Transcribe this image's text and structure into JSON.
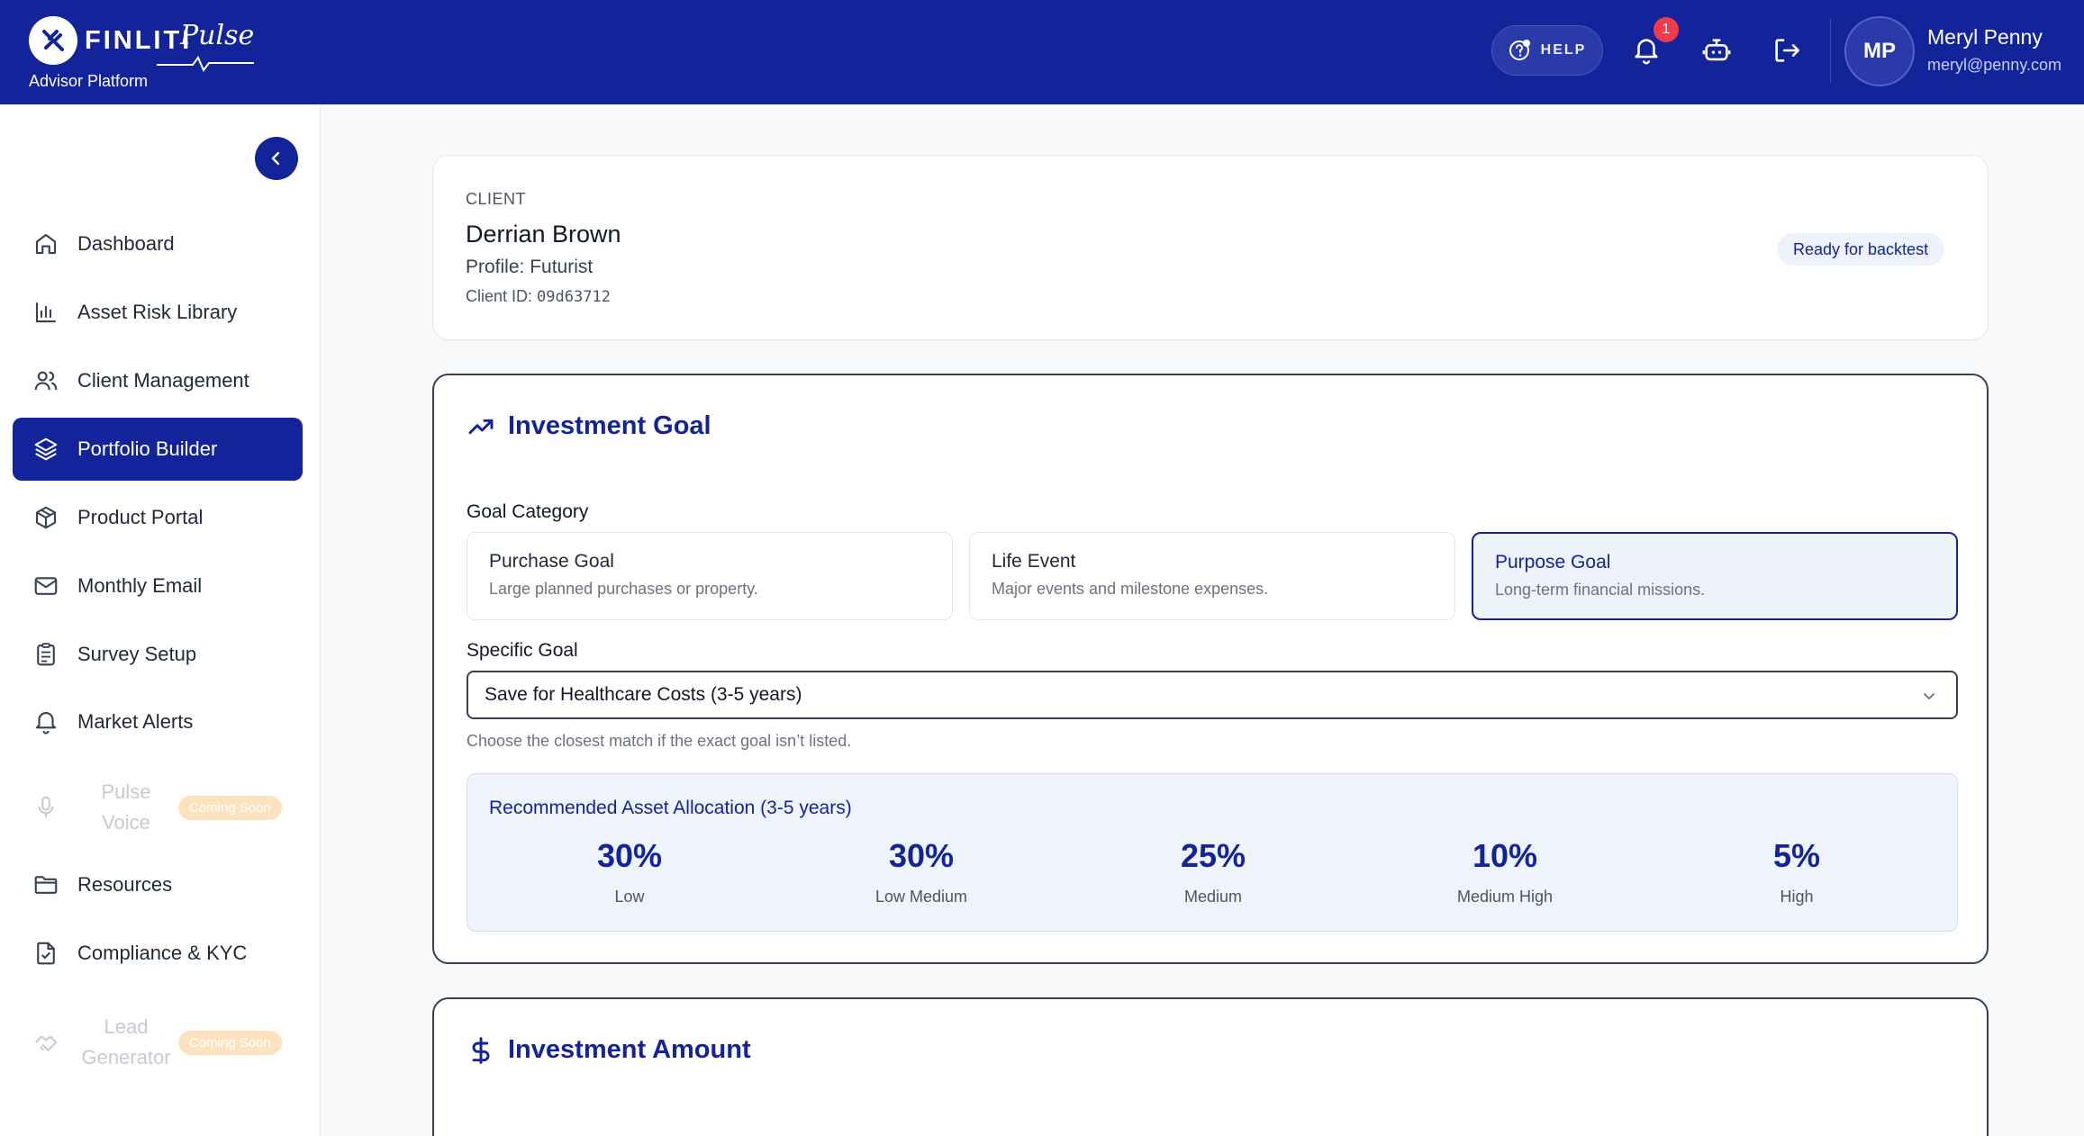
{
  "header": {
    "brand": "FINLITI",
    "brand_suffix": "Pulse",
    "platform": "Advisor Platform",
    "help_label": "HELP",
    "notification_count": "1",
    "user": {
      "initials": "MP",
      "name": "Meryl Penny",
      "email": "meryl@penny.com"
    },
    "icons": [
      "help-icon",
      "bell-icon",
      "robot-icon",
      "logout-icon"
    ]
  },
  "sidebar": {
    "items": [
      {
        "label": "Dashboard",
        "icon": "home-icon"
      },
      {
        "label": "Asset Risk Library",
        "icon": "bar-chart-icon"
      },
      {
        "label": "Client Management",
        "icon": "users-icon"
      },
      {
        "label": "Portfolio Builder",
        "icon": "layers-icon",
        "active": true
      },
      {
        "label": "Product Portal",
        "icon": "package-icon"
      },
      {
        "label": "Monthly Email",
        "icon": "mail-icon"
      },
      {
        "label": "Survey Setup",
        "icon": "clipboard-icon"
      },
      {
        "label": "Market Alerts",
        "icon": "bell-icon"
      },
      {
        "label_line1": "Pulse",
        "label_line2": "Voice",
        "icon": "mic-icon",
        "disabled": true,
        "badge": "Coming Soon"
      },
      {
        "label": "Resources",
        "icon": "folder-icon"
      },
      {
        "label": "Compliance & KYC",
        "icon": "file-check-icon"
      },
      {
        "label_line1": "Lead",
        "label_line2": "Generator",
        "icon": "handshake-icon",
        "disabled": true,
        "badge": "Coming Soon"
      }
    ]
  },
  "client": {
    "kicker": "CLIENT",
    "name": "Derrian Brown",
    "profile": "Profile: Futurist",
    "id_label": "Client ID:",
    "id_value": "09d63712",
    "status": "Ready for backtest"
  },
  "goal": {
    "title": "Investment Goal",
    "category_label": "Goal Category",
    "options": [
      {
        "title": "Purchase Goal",
        "desc": "Large planned purchases or property."
      },
      {
        "title": "Life Event",
        "desc": "Major events and milestone expenses."
      },
      {
        "title": "Purpose Goal",
        "desc": "Long-term financial missions.",
        "selected": true
      }
    ],
    "specific_label": "Specific Goal",
    "specific_value": "Save for Healthcare Costs (3-5 years)",
    "helper": "Choose the closest match if the exact goal isn’t listed.",
    "allocation": {
      "title": "Recommended Asset Allocation (3-5 years)",
      "items": [
        {
          "value": "30%",
          "label": "Low"
        },
        {
          "value": "30%",
          "label": "Low Medium"
        },
        {
          "value": "25%",
          "label": "Medium"
        },
        {
          "value": "10%",
          "label": "Medium High"
        },
        {
          "value": "5%",
          "label": "High"
        }
      ]
    }
  },
  "amount": {
    "title": "Investment Amount"
  },
  "colors": {
    "brand": "#13249a",
    "badge_red": "#ef3b4b",
    "soon_badge": "#fde2bf"
  }
}
